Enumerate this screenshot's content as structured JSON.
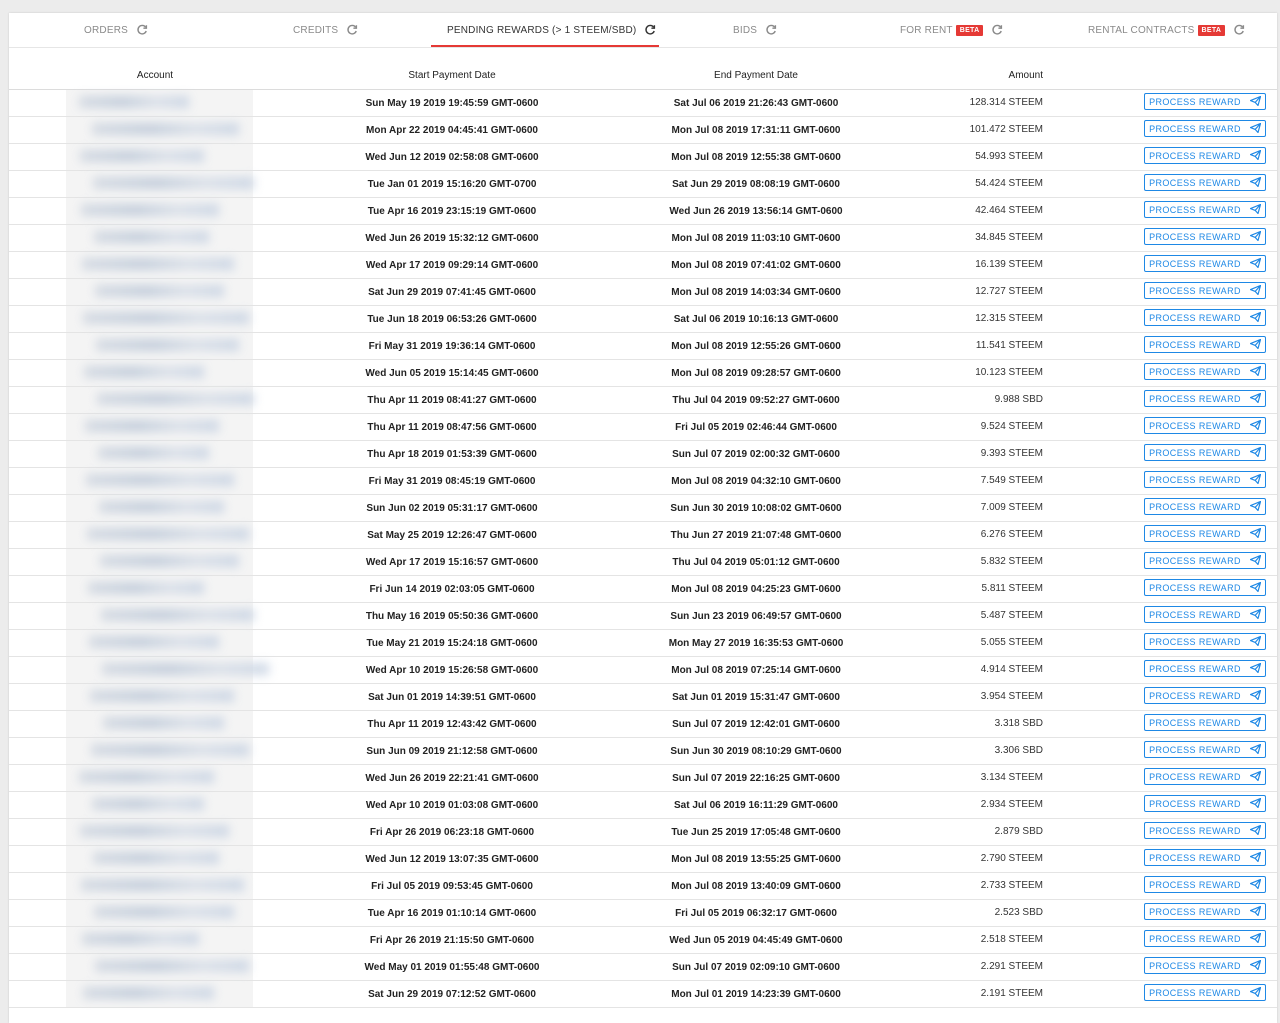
{
  "tabs": [
    {
      "label": "ORDERS",
      "beta": "",
      "refresh_icon": "refresh-icon"
    },
    {
      "label": "CREDITS",
      "beta": "",
      "refresh_icon": "refresh-icon"
    },
    {
      "label": "PENDING REWARDS (> 1 STEEM/SBD)",
      "beta": "",
      "refresh_icon": "refresh-icon"
    },
    {
      "label": "BIDS",
      "beta": "",
      "refresh_icon": "refresh-icon"
    },
    {
      "label": "FOR RENT",
      "beta": "BETA",
      "refresh_icon": "refresh-icon"
    },
    {
      "label": "RENTAL CONTRACTS",
      "beta": "BETA",
      "refresh_icon": "refresh-icon"
    }
  ],
  "active_tab": 2,
  "colors": {
    "accent": "#e53935",
    "button": "#1e88e5"
  },
  "table": {
    "headers": {
      "account": "Account",
      "start": "Start Payment Date",
      "end": "End Payment Date",
      "amount": "Amount"
    },
    "button_label": "PROCESS REWARD",
    "rows": [
      {
        "start": "Sun May 19 2019 19:45:59 GMT-0600",
        "end": "Sat Jul 06 2019 21:26:43 GMT-0600",
        "amount": "128.314 STEEM"
      },
      {
        "start": "Mon Apr 22 2019 04:45:41 GMT-0600",
        "end": "Mon Jul 08 2019 17:31:11 GMT-0600",
        "amount": "101.472 STEEM"
      },
      {
        "start": "Wed Jun 12 2019 02:58:08 GMT-0600",
        "end": "Mon Jul 08 2019 12:55:38 GMT-0600",
        "amount": "54.993 STEEM"
      },
      {
        "start": "Tue Jan 01 2019 15:16:20 GMT-0700",
        "end": "Sat Jun 29 2019 08:08:19 GMT-0600",
        "amount": "54.424 STEEM"
      },
      {
        "start": "Tue Apr 16 2019 23:15:19 GMT-0600",
        "end": "Wed Jun 26 2019 13:56:14 GMT-0600",
        "amount": "42.464 STEEM"
      },
      {
        "start": "Wed Jun 26 2019 15:32:12 GMT-0600",
        "end": "Mon Jul 08 2019 11:03:10 GMT-0600",
        "amount": "34.845 STEEM"
      },
      {
        "start": "Wed Apr 17 2019 09:29:14 GMT-0600",
        "end": "Mon Jul 08 2019 07:41:02 GMT-0600",
        "amount": "16.139 STEEM"
      },
      {
        "start": "Sat Jun 29 2019 07:41:45 GMT-0600",
        "end": "Mon Jul 08 2019 14:03:34 GMT-0600",
        "amount": "12.727 STEEM"
      },
      {
        "start": "Tue Jun 18 2019 06:53:26 GMT-0600",
        "end": "Sat Jul 06 2019 10:16:13 GMT-0600",
        "amount": "12.315 STEEM"
      },
      {
        "start": "Fri May 31 2019 19:36:14 GMT-0600",
        "end": "Mon Jul 08 2019 12:55:26 GMT-0600",
        "amount": "11.541 STEEM"
      },
      {
        "start": "Wed Jun 05 2019 15:14:45 GMT-0600",
        "end": "Mon Jul 08 2019 09:28:57 GMT-0600",
        "amount": "10.123 STEEM"
      },
      {
        "start": "Thu Apr 11 2019 08:41:27 GMT-0600",
        "end": "Thu Jul 04 2019 09:52:27 GMT-0600",
        "amount": "9.988 SBD"
      },
      {
        "start": "Thu Apr 11 2019 08:47:56 GMT-0600",
        "end": "Fri Jul 05 2019 02:46:44 GMT-0600",
        "amount": "9.524 STEEM"
      },
      {
        "start": "Thu Apr 18 2019 01:53:39 GMT-0600",
        "end": "Sun Jul 07 2019 02:00:32 GMT-0600",
        "amount": "9.393 STEEM"
      },
      {
        "start": "Fri May 31 2019 08:45:19 GMT-0600",
        "end": "Mon Jul 08 2019 04:32:10 GMT-0600",
        "amount": "7.549 STEEM"
      },
      {
        "start": "Sun Jun 02 2019 05:31:17 GMT-0600",
        "end": "Sun Jun 30 2019 10:08:02 GMT-0600",
        "amount": "7.009 STEEM"
      },
      {
        "start": "Sat May 25 2019 12:26:47 GMT-0600",
        "end": "Thu Jun 27 2019 21:07:48 GMT-0600",
        "amount": "6.276 STEEM"
      },
      {
        "start": "Wed Apr 17 2019 15:16:57 GMT-0600",
        "end": "Thu Jul 04 2019 05:01:12 GMT-0600",
        "amount": "5.832 STEEM"
      },
      {
        "start": "Fri Jun 14 2019 02:03:05 GMT-0600",
        "end": "Mon Jul 08 2019 04:25:23 GMT-0600",
        "amount": "5.811 STEEM"
      },
      {
        "start": "Thu May 16 2019 05:50:36 GMT-0600",
        "end": "Sun Jun 23 2019 06:49:57 GMT-0600",
        "amount": "5.487 STEEM"
      },
      {
        "start": "Tue May 21 2019 15:24:18 GMT-0600",
        "end": "Mon May 27 2019 16:35:53 GMT-0600",
        "amount": "5.055 STEEM"
      },
      {
        "start": "Wed Apr 10 2019 15:26:58 GMT-0600",
        "end": "Mon Jul 08 2019 07:25:14 GMT-0600",
        "amount": "4.914 STEEM"
      },
      {
        "start": "Sat Jun 01 2019 14:39:51 GMT-0600",
        "end": "Sat Jun 01 2019 15:31:47 GMT-0600",
        "amount": "3.954 STEEM"
      },
      {
        "start": "Thu Apr 11 2019 12:43:42 GMT-0600",
        "end": "Sun Jul 07 2019 12:42:01 GMT-0600",
        "amount": "3.318 SBD"
      },
      {
        "start": "Sun Jun 09 2019 21:12:58 GMT-0600",
        "end": "Sun Jun 30 2019 08:10:29 GMT-0600",
        "amount": "3.306 SBD"
      },
      {
        "start": "Wed Jun 26 2019 22:21:41 GMT-0600",
        "end": "Sun Jul 07 2019 22:16:25 GMT-0600",
        "amount": "3.134 STEEM"
      },
      {
        "start": "Wed Apr 10 2019 01:03:08 GMT-0600",
        "end": "Sat Jul 06 2019 16:11:29 GMT-0600",
        "amount": "2.934 STEEM"
      },
      {
        "start": "Fri Apr 26 2019 06:23:18 GMT-0600",
        "end": "Tue Jun 25 2019 17:05:48 GMT-0600",
        "amount": "2.879 SBD"
      },
      {
        "start": "Wed Jun 12 2019 13:07:35 GMT-0600",
        "end": "Mon Jul 08 2019 13:55:25 GMT-0600",
        "amount": "2.790 STEEM"
      },
      {
        "start": "Fri Jul 05 2019 09:53:45 GMT-0600",
        "end": "Mon Jul 08 2019 13:40:09 GMT-0600",
        "amount": "2.733 STEEM"
      },
      {
        "start": "Tue Apr 16 2019 01:10:14 GMT-0600",
        "end": "Fri Jul 05 2019 06:32:17 GMT-0600",
        "amount": "2.523 SBD"
      },
      {
        "start": "Fri Apr 26 2019 21:15:50 GMT-0600",
        "end": "Wed Jun 05 2019 04:45:49 GMT-0600",
        "amount": "2.518 STEEM"
      },
      {
        "start": "Wed May 01 2019 01:55:48 GMT-0600",
        "end": "Sun Jul 07 2019 02:09:10 GMT-0600",
        "amount": "2.291 STEEM"
      },
      {
        "start": "Sat Jun 29 2019 07:12:52 GMT-0600",
        "end": "Mon Jul 01 2019 14:23:39 GMT-0600",
        "amount": "2.191 STEEM"
      }
    ]
  }
}
